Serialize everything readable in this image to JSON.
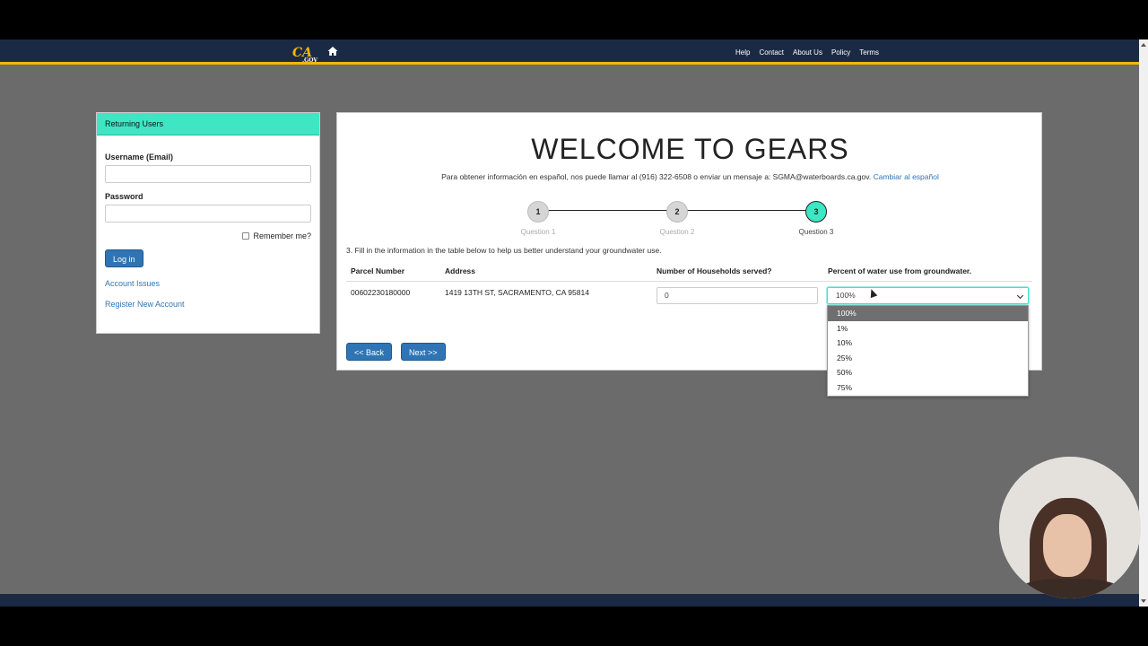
{
  "nav": {
    "logo_text": "CA",
    "logo_sub": ".GOV",
    "links": [
      "Help",
      "Contact",
      "About Us",
      "Policy",
      "Terms"
    ]
  },
  "login": {
    "header": "Returning Users",
    "username_label": "Username (Email)",
    "password_label": "Password",
    "remember_label": "Remember me?",
    "login_button": "Log in",
    "account_issues": "Account Issues",
    "register": "Register New Account"
  },
  "main": {
    "title": "WELCOME TO GEARS",
    "subtext": "Para obtener información en español, nos puede llamar al (916) 322-6508 o enviar un mensaje a: SGMA@waterboards.ca.gov.",
    "subtext_link": "Cambiar al español",
    "steps": [
      {
        "number": "1",
        "label": "Question 1",
        "active": false
      },
      {
        "number": "2",
        "label": "Question 2",
        "active": false
      },
      {
        "number": "3",
        "label": "Question 3",
        "active": true
      }
    ],
    "instruction": "3. Fill in the information in the table below to help us better understand your groundwater use.",
    "table": {
      "headers": [
        "Parcel Number",
        "Address",
        "Number of Households served?",
        "Percent of water use from groundwater."
      ],
      "row": {
        "parcel": "00602230180000",
        "address": "1419 13TH ST, SACRAMENTO, CA 95814",
        "households": "0",
        "percent": "100%"
      }
    },
    "back_button": "<< Back",
    "next_button": "Next >>"
  },
  "dropdown": {
    "options": [
      "100%",
      "1%",
      "10%",
      "25%",
      "50%",
      "75%"
    ],
    "selected": "100%"
  },
  "colors": {
    "accent": "#3ee6c4",
    "nav_bg": "#1b2a44",
    "nav_border": "#f5b700",
    "button": "#2f75b5"
  }
}
